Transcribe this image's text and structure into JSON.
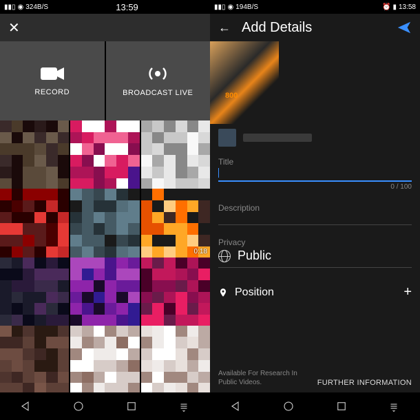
{
  "left": {
    "status": {
      "net": "324B/S",
      "time": "13:59"
    },
    "actions": {
      "record": "RECORD",
      "broadcast": "BROADCAST LIVE"
    },
    "thumbs": {
      "duration_3": "0:18"
    }
  },
  "right": {
    "status": {
      "net": "194B/S",
      "time": "13:58"
    },
    "header": {
      "title": "Add Details"
    },
    "form": {
      "title_label": "Title",
      "title_counter": "0 / 100",
      "desc_label": "Description",
      "privacy_label": "Privacy",
      "privacy_value": "Public",
      "position_label": "Position"
    },
    "footer": {
      "disclaimer": "Available For Research In Public Videos.",
      "more": "FURTHER INFORMATION"
    }
  }
}
